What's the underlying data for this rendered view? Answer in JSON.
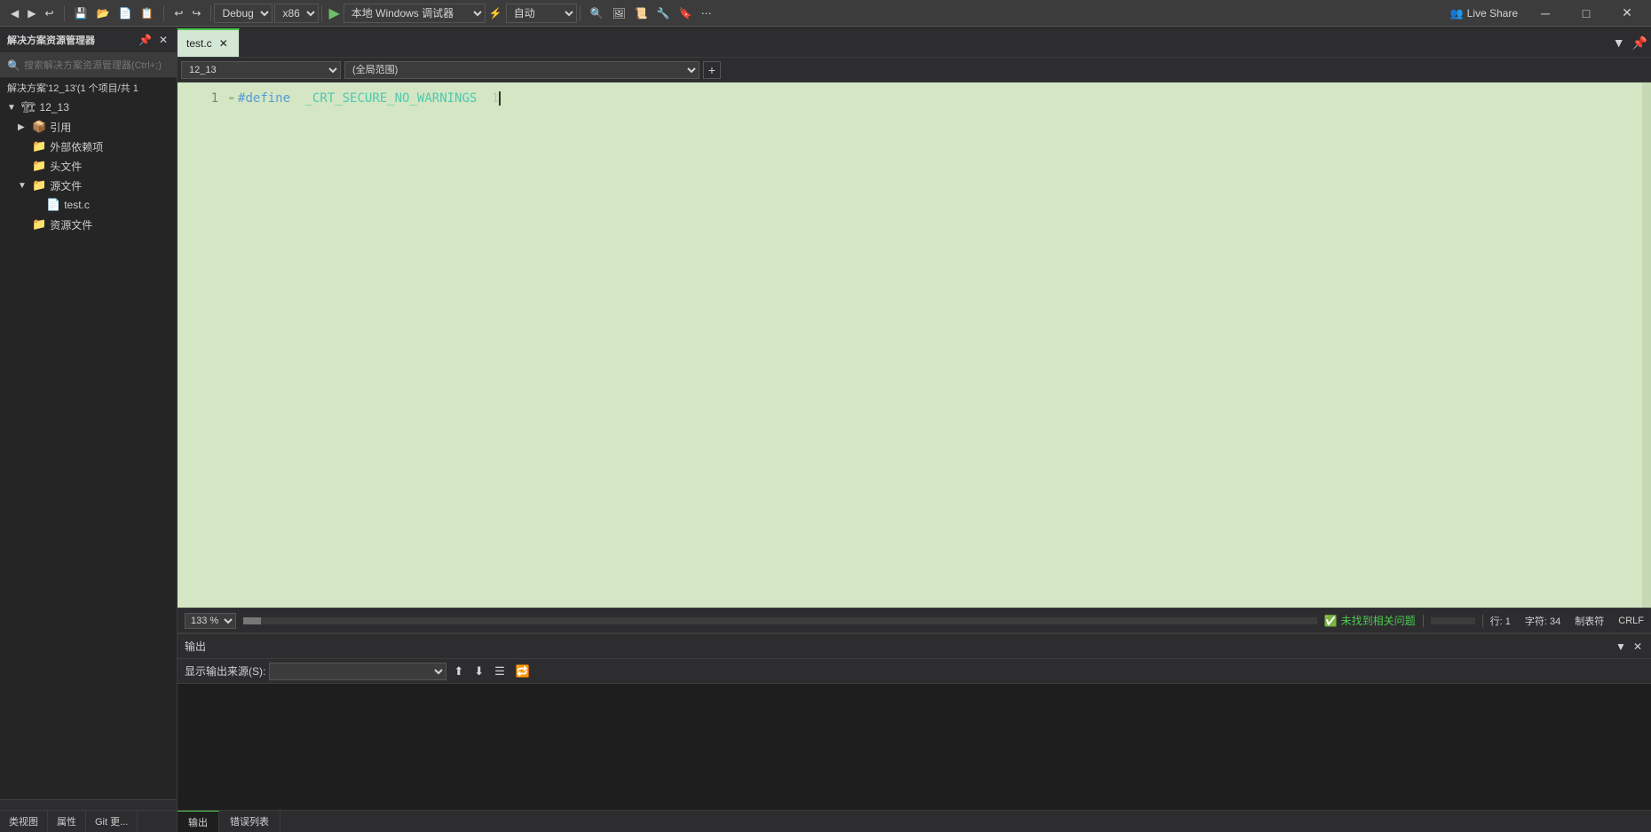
{
  "toolbar": {
    "debug_label": "Debug",
    "platform_label": "x86",
    "target_label": "本地 Windows 调试器",
    "auto_label": "自动",
    "live_share_label": "Live Share"
  },
  "sidebar": {
    "title": "解决方案资源管理器",
    "search_placeholder": "搜索解决方案资源管理器(Ctrl+;)",
    "solution_label": "解决方案'12_13'(1 个项目/共 1",
    "tree": [
      {
        "id": "project",
        "label": "12_13",
        "level": 1,
        "expanded": true,
        "icon": "▶"
      },
      {
        "id": "ref",
        "label": "引用",
        "level": 2,
        "expanded": false,
        "icon": "▶"
      },
      {
        "id": "deps",
        "label": "外部依赖项",
        "level": 2,
        "expanded": false,
        "icon": ""
      },
      {
        "id": "headers",
        "label": "头文件",
        "level": 2,
        "expanded": false,
        "icon": ""
      },
      {
        "id": "sources",
        "label": "源文件",
        "level": 2,
        "expanded": true,
        "icon": "▼"
      },
      {
        "id": "testc",
        "label": "test.c",
        "level": 3,
        "expanded": false,
        "icon": ""
      },
      {
        "id": "resources",
        "label": "资源文件",
        "level": 2,
        "expanded": false,
        "icon": ""
      }
    ],
    "bottom_tabs": [
      "类视图",
      "属性",
      "Git 更..."
    ]
  },
  "editor": {
    "tabs": [
      {
        "id": "testc",
        "label": "test.c",
        "active": true,
        "modified": false
      }
    ],
    "scope_dropdown": "12_13",
    "member_dropdown": "(全局范围)",
    "code_lines": [
      {
        "num": 1,
        "text": "#define _CRT_SECURE_NO_WARNINGS 1",
        "has_pencil": true
      }
    ]
  },
  "status_bar": {
    "zoom_label": "133 %",
    "message": "未找到相关问题",
    "row_label": "行: 1",
    "col_label": "字符: 34",
    "encoding_label": "制表符",
    "line_ending_label": "CRLF"
  },
  "output_panel": {
    "title": "输出",
    "source_label": "显示输出来源(S):",
    "source_value": ""
  },
  "bottom_tabs": [
    {
      "id": "output",
      "label": "输出",
      "active": true
    },
    {
      "id": "errors",
      "label": "错误列表"
    }
  ],
  "sidebar_bottom_tabs": [
    {
      "id": "class",
      "label": "类视图"
    },
    {
      "id": "props",
      "label": "属性"
    },
    {
      "id": "git",
      "label": "Git 更..."
    }
  ]
}
